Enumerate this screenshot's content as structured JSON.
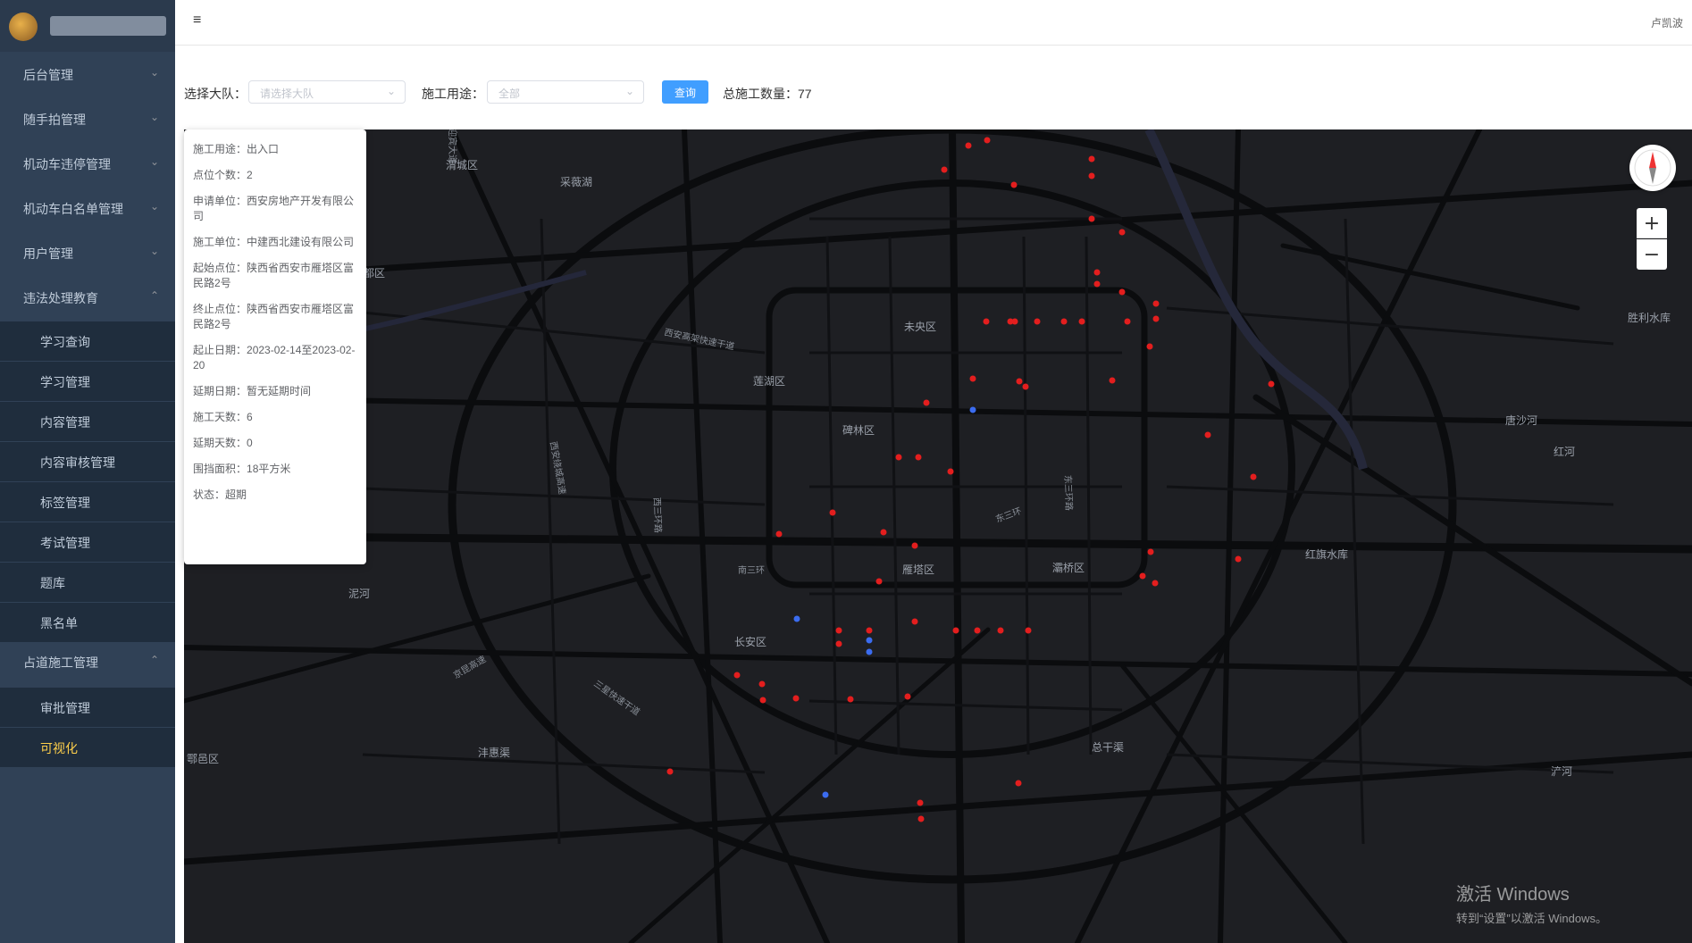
{
  "sidebar": {
    "menus": [
      {
        "label": "后台管理",
        "expanded": false
      },
      {
        "label": "随手拍管理",
        "expanded": false
      },
      {
        "label": "机动车违停管理",
        "expanded": false
      },
      {
        "label": "机动车白名单管理",
        "expanded": false
      },
      {
        "label": "用户管理",
        "expanded": false
      },
      {
        "label": "违法处理教育",
        "expanded": true
      },
      {
        "label": "占道施工管理",
        "expanded": true
      }
    ],
    "submenus_education": [
      "学习查询",
      "学习管理",
      "内容管理",
      "内容审核管理",
      "标签管理",
      "考试管理",
      "题库",
      "黑名单"
    ],
    "submenus_construction": [
      "审批管理",
      "可视化"
    ],
    "active_item": "可视化"
  },
  "navbar": {
    "menu_icon": "≡",
    "username": "卢凯波"
  },
  "filters": {
    "team_label": "选择大队：",
    "team_placeholder": "请选择大队",
    "use_label": "施工用途：",
    "use_value": "全部",
    "query_label": "查询",
    "total_label": "总施工数量：",
    "total_value": "77"
  },
  "info_card": {
    "rows": [
      {
        "key": "施工用途：",
        "value": "出入口"
      },
      {
        "key": "点位个数：",
        "value": "2"
      },
      {
        "key": "申请单位：",
        "value": "西安房地产开发有限公司"
      },
      {
        "key": "施工单位：",
        "value": "中建西北建设有限公司"
      },
      {
        "key": "起始点位：",
        "value": "陕西省西安市雁塔区富民路2号"
      },
      {
        "key": "终止点位：",
        "value": "陕西省西安市雁塔区富民路2号"
      },
      {
        "key": "起止日期：",
        "value": "2023-02-14至2023-02-20"
      },
      {
        "key": "延期日期：",
        "value": "暂无延期时间"
      },
      {
        "key": "施工天数：",
        "value": "6"
      },
      {
        "key": "延期天数：",
        "value": "0"
      },
      {
        "key": "围挡面积：",
        "value": "18平方米"
      },
      {
        "key": "状态：",
        "value": "超期"
      }
    ]
  },
  "map": {
    "district_labels": [
      "灞桥区",
      "未央区",
      "莲湖区",
      "碑林区",
      "雁塔区",
      "长安区",
      "鄠邑区",
      "秦都区",
      "渭城区",
      "胜利水库",
      "唐沙河",
      "红河",
      "红旗水库",
      "泥河",
      "采薇湖",
      "沣惠渠",
      "总干渠",
      "浐河"
    ],
    "road_labels": [
      "西安高架快速干道",
      "西安绕城高速",
      "西三环路",
      "东三环路",
      "南三环",
      "东三环",
      "三星快速干道",
      "京昆高速",
      "迎宾大道"
    ],
    "zoom_in": "+",
    "zoom_out": "−",
    "colors": {
      "overdue": "#e31e1e",
      "normal": "#3b6cf0",
      "road": "#0b0c0e",
      "background": "#1e1f23"
    }
  },
  "watermark": {
    "line1": "激活 Windows",
    "line2": "转到“设置”以激活 Windows。"
  }
}
